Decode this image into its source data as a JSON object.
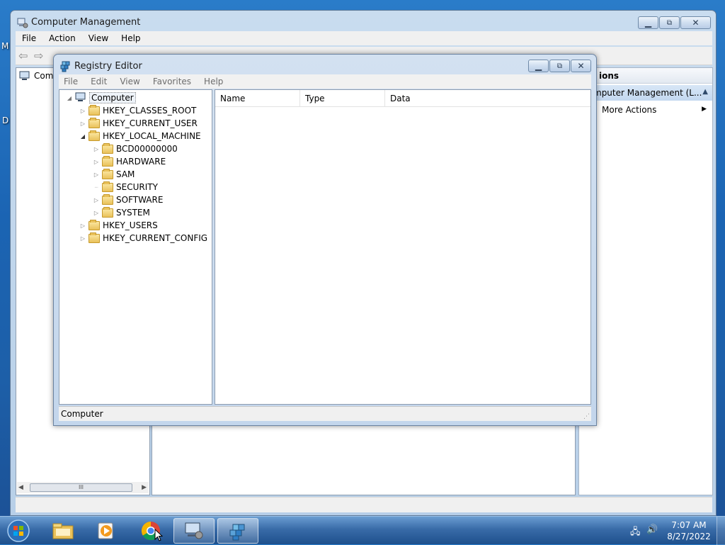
{
  "desktop": {
    "icon_fragment_1": "M",
    "icon_fragment_2": "D"
  },
  "computer_management": {
    "title": "Computer Management",
    "menu": [
      "File",
      "Action",
      "View",
      "Help"
    ],
    "tree_root": "Comp",
    "actions_header": "ions",
    "actions_item": "mputer Management (L...",
    "more_actions": "More Actions",
    "scroll_thumb_grip": "III"
  },
  "registry_editor": {
    "title": "Registry Editor",
    "menu": [
      "File",
      "Edit",
      "View",
      "Favorites",
      "Help"
    ],
    "tree": {
      "root": "Computer",
      "hives": [
        "HKEY_CLASSES_ROOT",
        "HKEY_CURRENT_USER",
        "HKEY_LOCAL_MACHINE"
      ],
      "local_machine_children": [
        "BCD00000000",
        "HARDWARE",
        "SAM",
        "SECURITY",
        "SOFTWARE",
        "SYSTEM"
      ],
      "hives_after": [
        "HKEY_USERS",
        "HKEY_CURRENT_CONFIG"
      ]
    },
    "columns": [
      "Name",
      "Type",
      "Data"
    ],
    "status": "Computer"
  },
  "taskbar": {
    "time": "7:07 AM",
    "date": "8/27/2022",
    "apps": [
      "start-orb-icon",
      "explorer-icon",
      "media-player-icon",
      "chrome-icon",
      "computer-management-icon",
      "regedit-icon"
    ]
  }
}
